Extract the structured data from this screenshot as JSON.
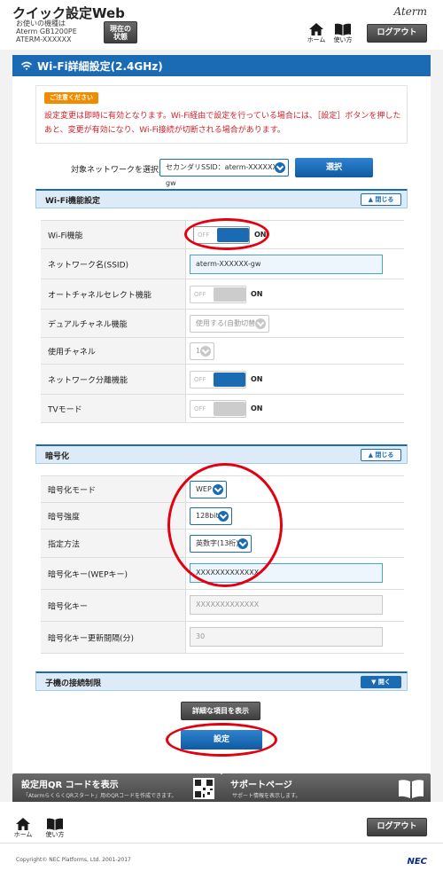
{
  "header": {
    "title": "クイック設定Web",
    "device_label": "お使いの機種は",
    "model": "Aterm GB1200PE",
    "device_name": "ATERM-XXXXXX",
    "status_button_line1": "現在の",
    "status_button_line2": "状態",
    "home_label": "ホーム",
    "guide_label": "使い方",
    "logout_label": "ログアウト",
    "brand": "Aterm"
  },
  "page_title": "Wi-Fi詳細設定(2.4GHz)",
  "notice": {
    "badge": "ご注意ください",
    "text": "設定変更は即時に有効となります。Wi-Fi経由で設定を行っている場合には、［設定］ボタンを押したあと、変更が有効になり、Wi-Fi接続が切断される場合があります。"
  },
  "target_network": {
    "label": "対象ネットワークを選択",
    "value": "セカンダリSSID：aterm-XXXXXX-gw",
    "select_button": "選択"
  },
  "wifi_section": {
    "title": "Wi-Fi機能設定",
    "collapse_label": "閉じる",
    "rows": [
      {
        "label": "Wi-Fi機能",
        "off": "OFF",
        "on": "ON"
      },
      {
        "label": "ネットワーク名(SSID)",
        "value": "aterm-XXXXXX-gw"
      },
      {
        "label": "オートチャネルセレクト機能",
        "off": "OFF",
        "on": "ON"
      },
      {
        "label": "デュアルチャネル機能",
        "value": "使用する(自動切替)"
      },
      {
        "label": "使用チャネル",
        "value": "1"
      },
      {
        "label": "ネットワーク分離機能",
        "off": "OFF",
        "on": "ON"
      },
      {
        "label": "TVモード",
        "off": "OFF",
        "on": "ON"
      }
    ]
  },
  "encryption_section": {
    "title": "暗号化",
    "collapse_label": "閉じる",
    "rows": [
      {
        "label": "暗号化モード",
        "value": "WEP"
      },
      {
        "label": "暗号強度",
        "value": "128bit"
      },
      {
        "label": "指定方法",
        "value": "英数字(13桁)"
      },
      {
        "label": "暗号化キー(WEPキー)",
        "value": "XXXXXXXXXXXXX"
      },
      {
        "label": "暗号化キー",
        "value": "XXXXXXXXXXXXX"
      },
      {
        "label": "暗号化キー更新間隔(分)",
        "value": "30"
      }
    ]
  },
  "client_section": {
    "title": "子機の接続制限",
    "expand_label": "開く"
  },
  "detail_button": "詳細な項目を表示",
  "set_button": "設定",
  "qr_card": {
    "title": "設定用QR コードを表示",
    "subtitle": "「AtermらくらくQRスタート」用のQRコードを作成できます。"
  },
  "support_card": {
    "title": "サポートページ",
    "subtitle": "サポート情報を表示します。"
  },
  "footer": {
    "home_label": "ホーム",
    "guide_label": "使い方",
    "logout_label": "ログアウト",
    "copyright": "Copyright© NEC Platforms, Ltd. 2001-2017",
    "brand": "NEC"
  },
  "colors": {
    "accent": "#1b6bb4",
    "highlight_ring": "#e3000f",
    "notice_text": "#d5202a",
    "badge": "#f08c00"
  }
}
